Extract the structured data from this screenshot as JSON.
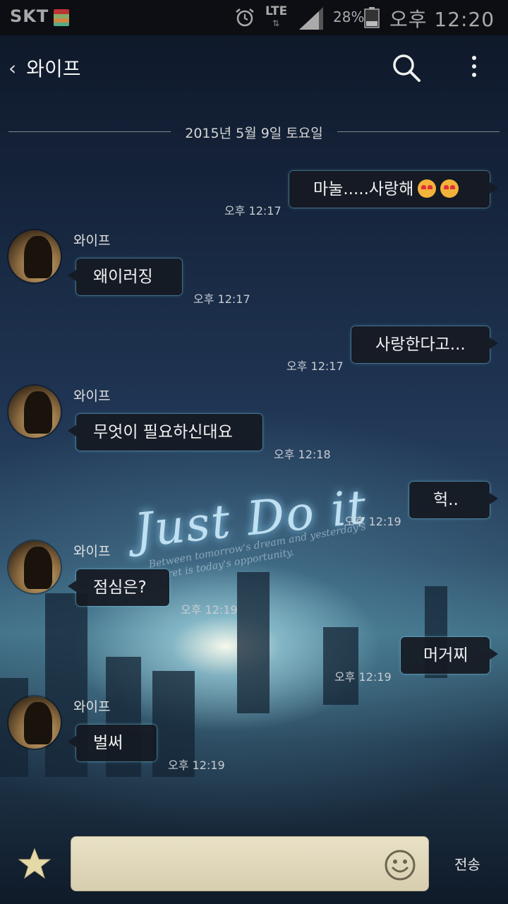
{
  "status_bar": {
    "carrier": "SKT",
    "network": "LTE",
    "network_arrows": "⇅",
    "battery_percent": "28%",
    "time": "오후 12:20"
  },
  "header": {
    "back_chevron": "‹",
    "title": "와이프"
  },
  "date_divider": "2015년 5월 9일 토요일",
  "messages": [
    {
      "side": "out",
      "text": "마눌.....사랑해",
      "time": "오후 12:17",
      "emoji_count": 2
    },
    {
      "side": "in",
      "sender": "와이프",
      "text": "왜이러징",
      "time": "오후 12:17"
    },
    {
      "side": "out",
      "text": "사랑한다고...",
      "time": "오후 12:17"
    },
    {
      "side": "in",
      "sender": "와이프",
      "text": "무엇이 필요하신대요",
      "time": "오후 12:18"
    },
    {
      "side": "out",
      "text": "헉..",
      "time": "오후 12:19"
    },
    {
      "side": "in",
      "sender": "와이프",
      "text": "점심은?",
      "time": "오후 12:19"
    },
    {
      "side": "out",
      "text": "머거찌",
      "time": "오후 12:19"
    },
    {
      "side": "in",
      "sender": "와이프",
      "text": "벌써",
      "time": "오후 12:19"
    }
  ],
  "wallpaper": {
    "title": "Just Do it",
    "subtitle": "Between tomorrow's dream and yesterday's regret is today's opportunity."
  },
  "input": {
    "placeholder": "",
    "send_label": "전송"
  },
  "icons": {
    "alarm": "alarm-icon",
    "signal": "signal-icon",
    "battery": "battery-icon",
    "search": "search-icon",
    "more": "more-vertical-icon",
    "star": "star-icon",
    "emoji": "smiley-icon",
    "heart_eyes": "heart-eyes-emoji-icon"
  },
  "colors": {
    "bubble_bg": "#161a22",
    "bubble_glow": "#78c8e6",
    "input_bg": "#e9e1c6",
    "star": "#e6d9a8"
  }
}
